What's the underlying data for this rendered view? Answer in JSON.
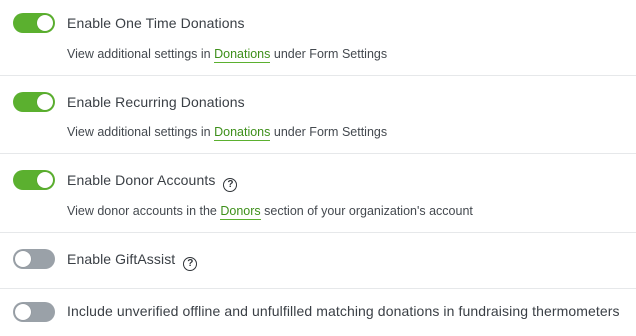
{
  "settings": {
    "one_time": {
      "label": "Enable One Time Donations",
      "enabled": true,
      "desc_prefix": "View additional settings in ",
      "link": "Donations",
      "desc_suffix": " under Form Settings"
    },
    "recurring": {
      "label": "Enable Recurring Donations",
      "enabled": true,
      "desc_prefix": "View additional settings in ",
      "link": "Donations",
      "desc_suffix": " under Form Settings"
    },
    "donor_accounts": {
      "label": "Enable Donor Accounts",
      "enabled": true,
      "help_icon": "question-circle-icon",
      "help_glyph": "?",
      "desc_prefix": "View donor accounts in the ",
      "link": "Donors",
      "desc_suffix": " section of your organization's account"
    },
    "gift_assist": {
      "label": "Enable GiftAssist",
      "enabled": false,
      "help_icon": "question-circle-icon",
      "help_glyph": "?"
    },
    "unverified_matching": {
      "label": "Include unverified offline and unfulfilled matching donations in fundraising thermometers",
      "enabled": false
    }
  },
  "colors": {
    "toggle_on": "#5bb02f",
    "toggle_off": "#9aa1a8",
    "link": "#3d8f1a",
    "divider": "#e6e8ea"
  }
}
